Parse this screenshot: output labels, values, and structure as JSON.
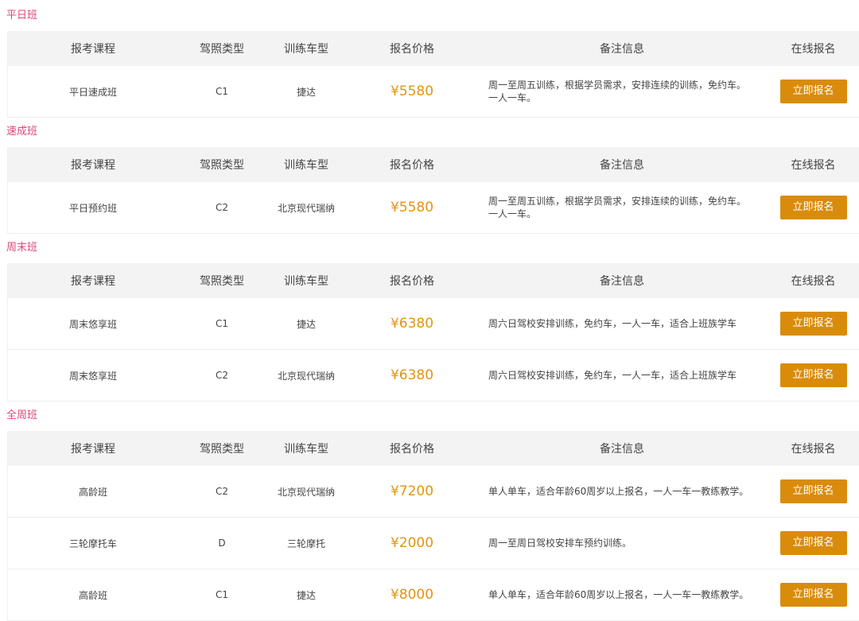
{
  "headers": {
    "course": "报考课程",
    "license": "驾照类型",
    "car": "训练车型",
    "price": "报名价格",
    "note": "备注信息",
    "action": "在线报名"
  },
  "button_label": "立即报名",
  "colors": {
    "section_title": "#e0457a",
    "price": "#e39412",
    "button": "#d98c0b",
    "header_bg": "#f3f3f3"
  },
  "sections": [
    {
      "title": "平日班",
      "rows": [
        {
          "course": "平日速成班",
          "license": "C1",
          "car": "捷达",
          "price": "¥5580",
          "note": "周一至周五训练，根据学员需求，安排连续的训练，免约车。一人一车。"
        }
      ]
    },
    {
      "title": "速成班",
      "rows": [
        {
          "course": "平日预约班",
          "license": "C2",
          "car": "北京现代瑞纳",
          "price": "¥5580",
          "note": "周一至周五训练，根据学员需求，安排连续的训练，免约车。一人一车。"
        }
      ]
    },
    {
      "title": "周末班",
      "rows": [
        {
          "course": "周末悠享班",
          "license": "C1",
          "car": "捷达",
          "price": "¥6380",
          "note": "周六日驾校安排训练，免约车，一人一车，适合上班族学车"
        },
        {
          "course": "周末悠享班",
          "license": "C2",
          "car": "北京现代瑞纳",
          "price": "¥6380",
          "note": "周六日驾校安排训练，免约车，一人一车，适合上班族学车"
        }
      ]
    },
    {
      "title": "全周班",
      "rows": [
        {
          "course": "高龄班",
          "license": "C2",
          "car": "北京现代瑞纳",
          "price": "¥7200",
          "note": "单人单车，适合年龄60周岁以上报名，一人一车一教练教学。"
        },
        {
          "course": "三轮摩托车",
          "license": "D",
          "car": "三轮摩托",
          "price": "¥2000",
          "note": "周一至周日驾校安排车预约训练。"
        },
        {
          "course": "高龄班",
          "license": "C1",
          "car": "捷达",
          "price": "¥8000",
          "note": "单人单车，适合年龄60周岁以上报名，一人一车一教练教学。"
        }
      ]
    }
  ]
}
